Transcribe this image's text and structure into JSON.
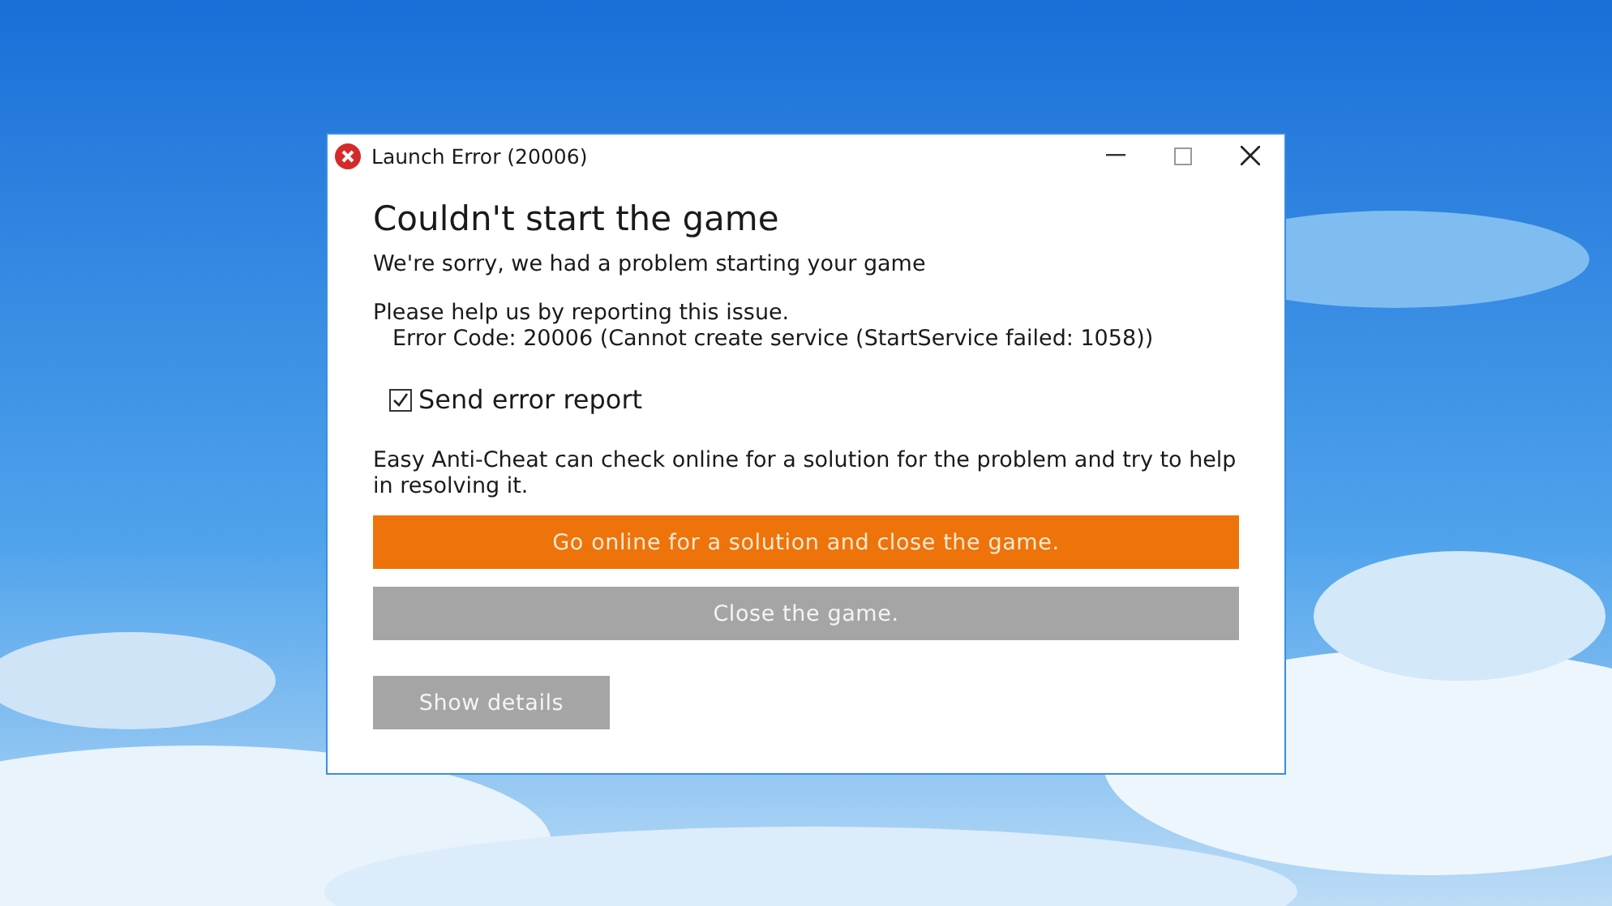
{
  "window": {
    "title": "Launch Error (20006)"
  },
  "dialog": {
    "heading": "Couldn't start the game",
    "subtitle": "We're sorry, we had a problem starting your game",
    "report_prompt": "Please help us by reporting this issue.",
    "error_code": "Error Code: 20006 (Cannot create service (StartService failed: 1058))",
    "send_report": {
      "label": "Send error report",
      "checked": true
    },
    "info": "Easy Anti-Cheat can check online for a solution for the problem and try to help in resolving it.",
    "buttons": [
      {
        "label": "Go online for a solution and close the game.",
        "kind": "primary"
      },
      {
        "label": "Close the game.",
        "kind": "secondary"
      }
    ],
    "details_button": {
      "label": "Show details"
    }
  }
}
